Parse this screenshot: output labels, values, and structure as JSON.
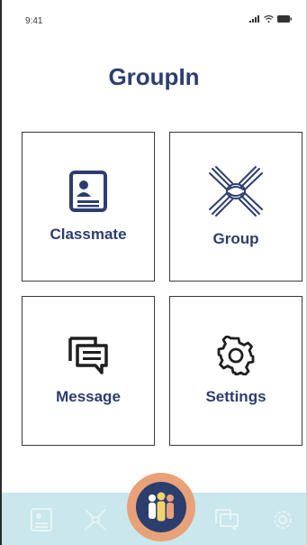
{
  "status_bar": {
    "time": "9:41"
  },
  "app": {
    "title": "GroupIn"
  },
  "tiles": [
    {
      "label": "Classmate",
      "icon": "contact-card-icon"
    },
    {
      "label": "Group",
      "icon": "hands-group-icon"
    },
    {
      "label": "Message",
      "icon": "chat-bubbles-icon"
    },
    {
      "label": "Settings",
      "icon": "gear-icon"
    }
  ],
  "bottom_nav": {
    "items": [
      {
        "icon": "contact-card-icon"
      },
      {
        "icon": "hands-group-icon"
      },
      {
        "icon": "people-group-icon",
        "active": true
      },
      {
        "icon": "chat-bubbles-icon"
      },
      {
        "icon": "gear-icon"
      }
    ]
  },
  "colors": {
    "primary": "#2c3e6e",
    "nav_background": "#c9e7ec",
    "center_button": "#e9a17a"
  }
}
